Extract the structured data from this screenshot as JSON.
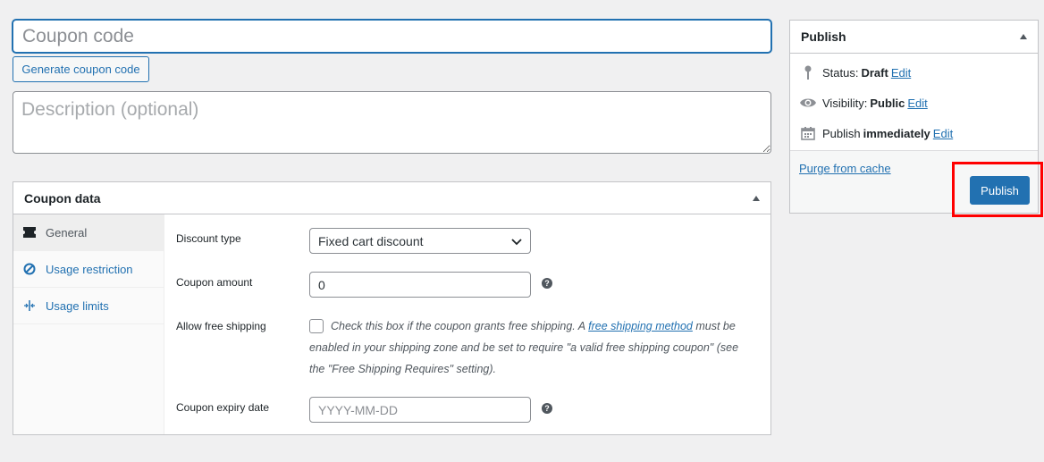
{
  "title_input": {
    "placeholder": "Coupon code",
    "value": ""
  },
  "generate_button": {
    "label": "Generate coupon code"
  },
  "description": {
    "placeholder": "Description (optional)"
  },
  "coupon_data": {
    "title": "Coupon data",
    "tabs": [
      {
        "label": "General",
        "icon": "ticket-icon",
        "active": true
      },
      {
        "label": "Usage restriction",
        "icon": "block-icon",
        "active": false
      },
      {
        "label": "Usage limits",
        "icon": "limits-icon",
        "active": false
      }
    ],
    "general": {
      "discount_type": {
        "label": "Discount type",
        "value": "Fixed cart discount"
      },
      "coupon_amount": {
        "label": "Coupon amount",
        "value": "0"
      },
      "free_shipping": {
        "label": "Allow free shipping",
        "desc_before": "Check this box if the coupon grants free shipping. A ",
        "link": "free shipping method",
        "desc_after": " must be enabled in your shipping zone and be set to require \"a valid free shipping coupon\" (see the \"Free Shipping Requires\" setting)."
      },
      "expiry": {
        "label": "Coupon expiry date",
        "placeholder": "YYYY-MM-DD"
      }
    }
  },
  "publish": {
    "title": "Publish",
    "status": {
      "label": "Status:",
      "value": "Draft",
      "edit": "Edit"
    },
    "visibility": {
      "label": "Visibility:",
      "value": "Public",
      "edit": "Edit"
    },
    "schedule": {
      "label": "Publish",
      "value": "immediately",
      "edit": "Edit"
    },
    "purge_link": "Purge from cache",
    "button": "Publish"
  },
  "colors": {
    "accent": "#2271b1",
    "highlight": "#ff0000"
  }
}
